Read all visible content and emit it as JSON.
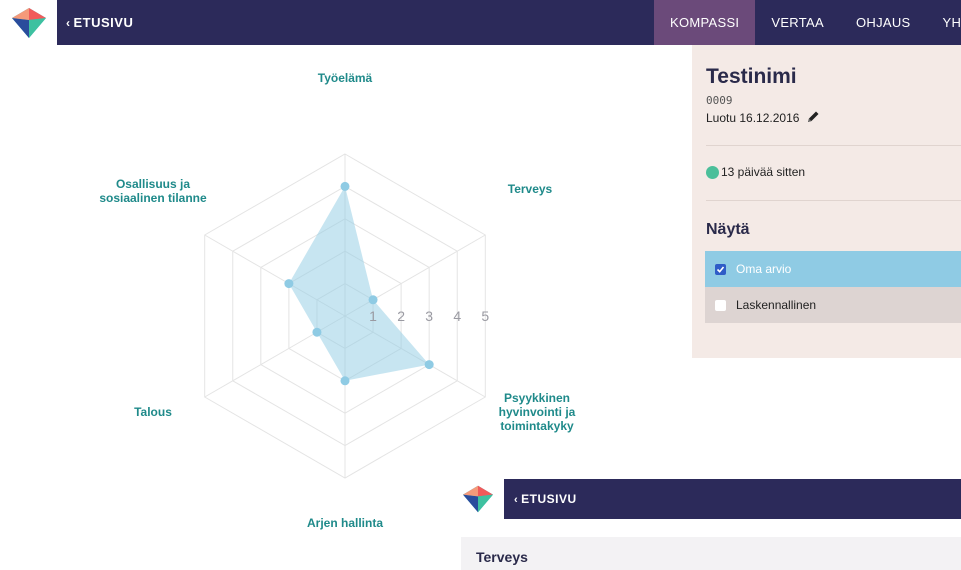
{
  "header": {
    "back_label": "ETUSIVU",
    "back_chevron": "‹",
    "logo_icon": "diamond-logo",
    "nav": [
      "KOMPASSI",
      "VERTAA",
      "OHJAUS",
      "YHT"
    ],
    "active_nav": "KOMPASSI"
  },
  "chart_data": {
    "type": "radar",
    "axes": [
      "Työelämä",
      "Terveys",
      "Psyykkinen hyvinvointi ja toimintakyky",
      "Arjen hallinta",
      "Talous",
      "Osallisuus ja sosiaalinen tilanne"
    ],
    "axis_label_lines": [
      [
        "Työelämä"
      ],
      [
        "Terveys"
      ],
      [
        "Psyykkinen",
        "hyvinvointi ja",
        "toimintakyky"
      ],
      [
        "Arjen hallinta"
      ],
      [
        "Talous"
      ],
      [
        "Osallisuus ja",
        "sosiaalinen tilanne"
      ]
    ],
    "scale_ticks": [
      "1",
      "2",
      "3",
      "4",
      "5"
    ],
    "range": [
      0,
      5
    ],
    "series": [
      {
        "values": [
          4,
          1,
          3,
          2,
          1,
          2
        ],
        "color": "#8fcbe4"
      }
    ]
  },
  "panel": {
    "name": "Testinimi",
    "id": "0009",
    "created": "Luotu 16.12.2016",
    "status": "13 päivää sitten",
    "show_title": "Näytä",
    "options": [
      {
        "label": "Oma arvio",
        "checked": true
      },
      {
        "label": "Laskennallinen",
        "checked": false
      }
    ]
  },
  "mini": {
    "back_label": "ETUSIVU",
    "back_chevron": "‹",
    "section_title": "Terveys"
  },
  "colors": {
    "navbar": "#2c2a5a",
    "active_tab": "#6b4a7a",
    "axis_label": "#1f8a8a",
    "panel_bg": "#f4eae6",
    "status_dot": "#4bbf9a"
  }
}
